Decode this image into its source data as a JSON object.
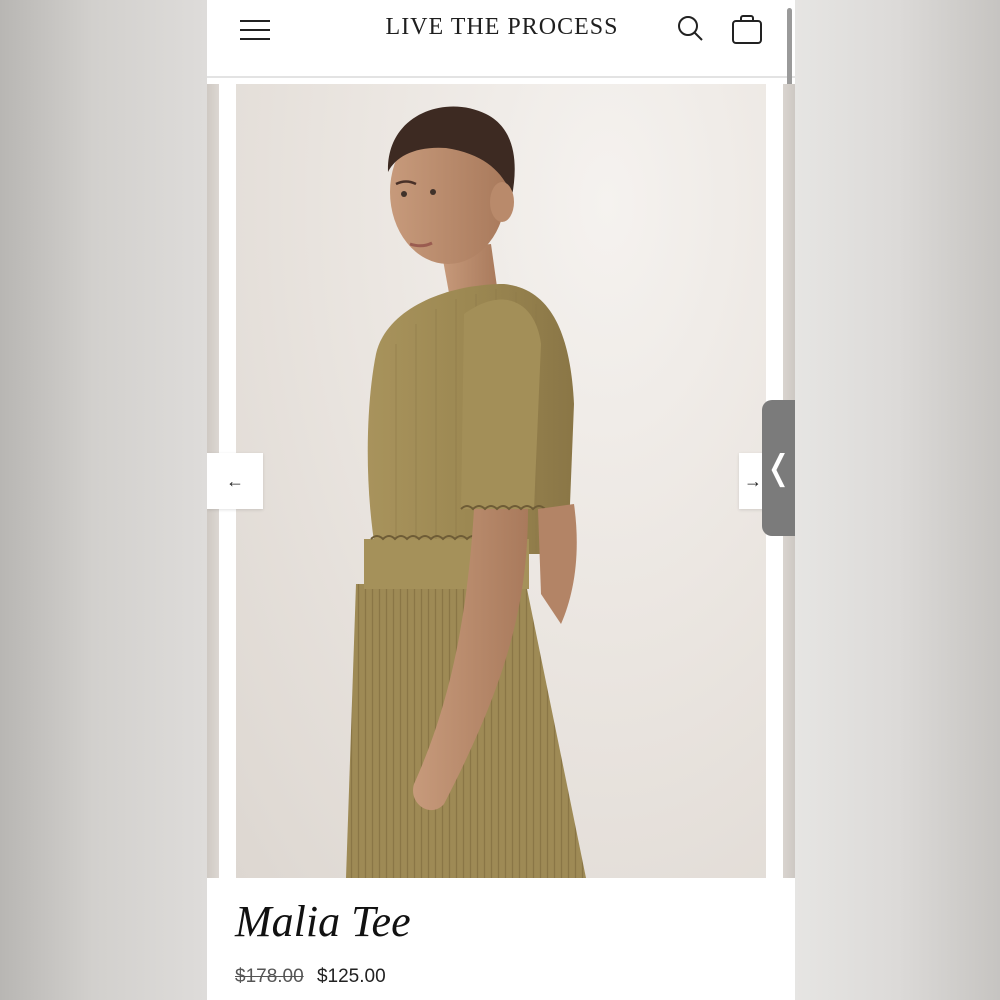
{
  "header": {
    "brand": "LIVE THE PROCESS",
    "menu_icon": "hamburger-menu-icon",
    "search_icon": "search-icon",
    "cart_icon": "shopping-bag-icon"
  },
  "gallery": {
    "prev_arrow": "←",
    "next_arrow": "→",
    "photo_subject": "model-photo"
  },
  "side_tab": {
    "glyph": "❬"
  },
  "product": {
    "title": "Malia Tee",
    "price_original": "$178.00",
    "price_sale": "$125.00"
  },
  "colors": {
    "garment": "#9e8a55",
    "background": "#ffffff",
    "text": "#111111"
  }
}
